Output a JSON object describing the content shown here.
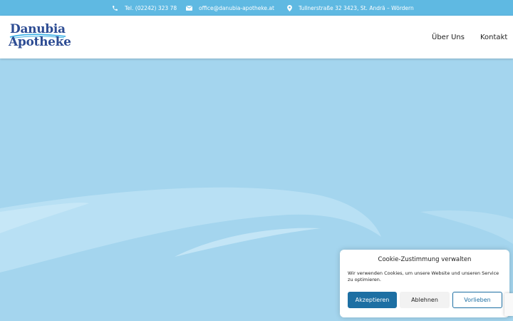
{
  "topbar": {
    "phone": "Tel. (02242) 323 78",
    "email": "office@danubia-apotheke.at",
    "address": "Tullnerstraße 32 3423, St. Andrä – Wördern",
    "icons": [
      "phone-icon",
      "envelope-icon",
      "map-pin-icon"
    ]
  },
  "header": {
    "logo": {
      "line1": "Danubia",
      "line2": "Apotheke"
    },
    "nav": [
      {
        "label": "Über Uns"
      },
      {
        "label": "Kontakt"
      }
    ]
  },
  "cookie_banner": {
    "title": "Cookie-Zustimmung verwalten",
    "text": "Wir verwenden Cookies, um unsere Website und unseren Service zu optimieren.",
    "accept_label": "Akzeptieren",
    "deny_label": "Ablehnen",
    "preferences_label": "Vorlieben"
  },
  "colors": {
    "topbar": "#5fb9e2",
    "hero": "#a4d5ee",
    "brand": "#2d4c93",
    "accent": "#1d6fa3"
  }
}
